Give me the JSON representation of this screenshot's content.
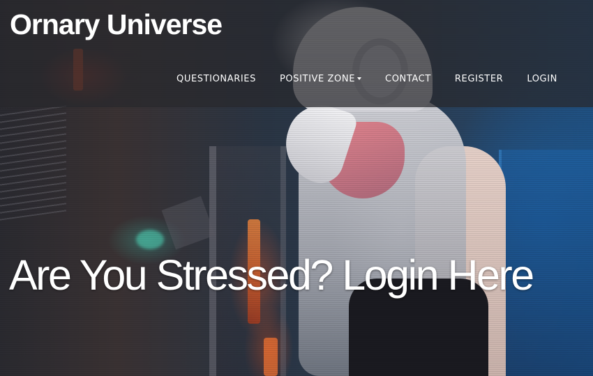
{
  "header": {
    "brand": "Ornary Universe"
  },
  "nav": {
    "items": [
      {
        "label": "QUESTIONARIES",
        "has_dropdown": false
      },
      {
        "label": "POSITIVE ZONE",
        "has_dropdown": true
      },
      {
        "label": "CONTACT",
        "has_dropdown": false
      },
      {
        "label": "REGISTER",
        "has_dropdown": false
      },
      {
        "label": "LOGIN",
        "has_dropdown": false
      }
    ]
  },
  "hero": {
    "headline": "Are You Stressed? Login Here",
    "image": "dj-background-photo"
  },
  "colors": {
    "header_overlay": "#28282C",
    "text": "#FFFFFF",
    "accent_blue": "#1F4F7F"
  },
  "icons": {
    "dropdown": "caret-down-icon"
  }
}
